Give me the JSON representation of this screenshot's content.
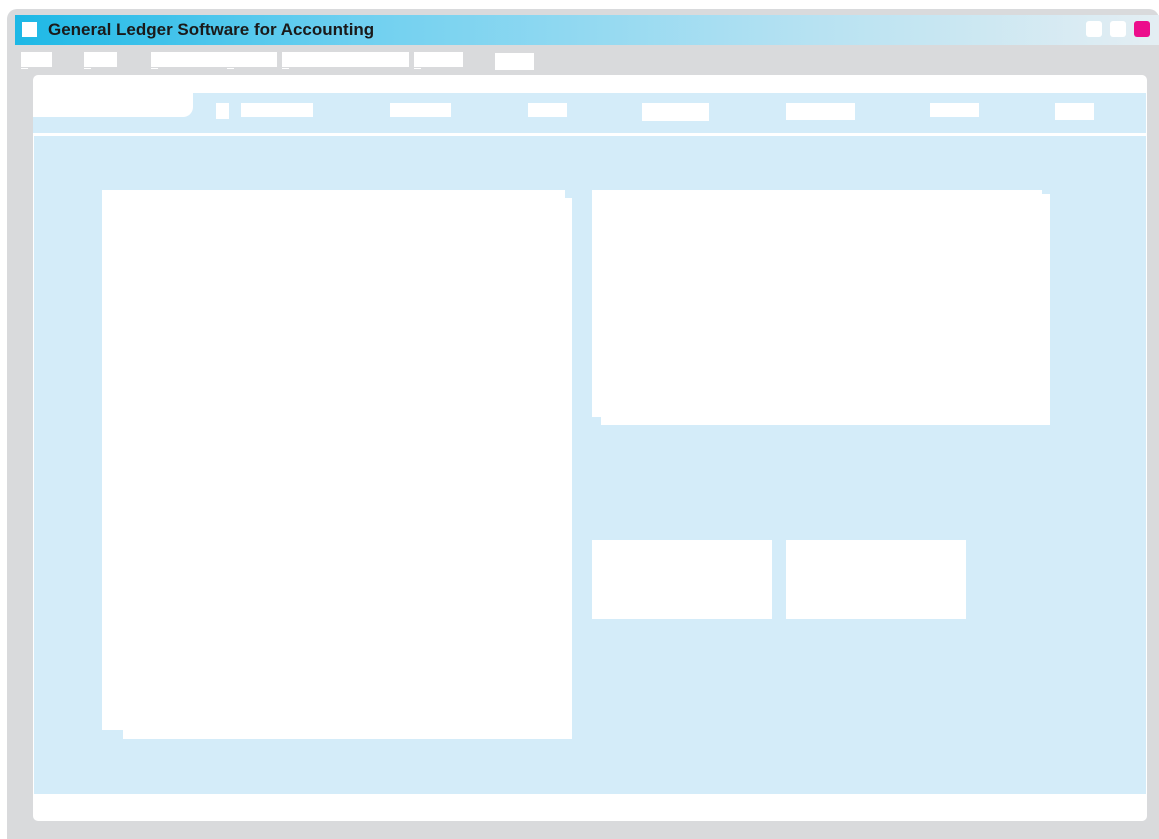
{
  "window": {
    "title": "General Ledger Software for Accounting",
    "accent_color": "#1db8e6",
    "close_button_color": "#ec0e8c",
    "icons": [
      "app-icon",
      "minimize-icon",
      "maximize-icon",
      "close-icon"
    ]
  },
  "menu": {
    "item_count": 7
  },
  "tabs": {
    "item_count": 7,
    "active_index": 0
  },
  "colors": {
    "frame": "#d9dadc",
    "content_background": "#d4ecf9",
    "panel": "#ffffff"
  }
}
